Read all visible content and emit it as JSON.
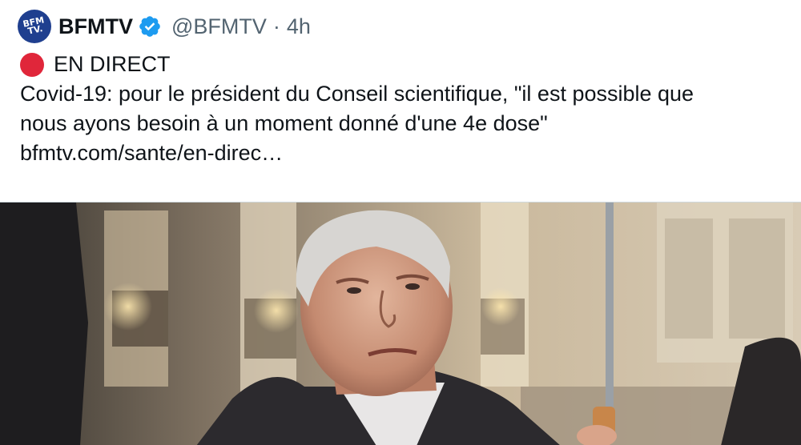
{
  "tweet": {
    "avatar_text": "BFM TV.",
    "display_name": "BFMTV",
    "handle": "@BFMTV",
    "separator": "·",
    "time": "4h",
    "live_label": "EN DIRECT",
    "text_line_1": "Covid-19: pour le président du Conseil scientifique, \"il est possible que",
    "text_line_2": "nous ayons besoin à un moment donné d'une 4e dose\"",
    "link": "bfmtv.com/sante/en-direc…",
    "icons": {
      "verified": "verified-badge-icon",
      "live": "red-circle-icon"
    },
    "colors": {
      "verified": "#1d9bf0",
      "live_dot": "#e0263a",
      "avatar_bg": "#1f3f8f",
      "muted": "#536471"
    }
  }
}
